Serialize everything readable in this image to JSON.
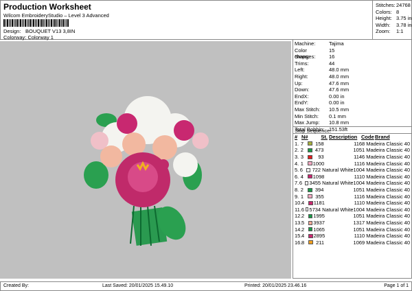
{
  "header": {
    "title": "Production Worksheet",
    "subtitle": "Wilcom EmbroideryStudio – Level 3 Advanced",
    "design_label": "Design:",
    "design": "BOUQUET V13 3,8IN",
    "colorway_label": "Colorway:",
    "colorway": "Colorway 1"
  },
  "stats": [
    {
      "k": "Stitches:",
      "v": "24768"
    },
    {
      "k": "Colors:",
      "v": "8"
    },
    {
      "k": "Height:",
      "v": "3.75 in"
    },
    {
      "k": "Width:",
      "v": "3.78 in"
    },
    {
      "k": "Zoom:",
      "v": "1:1"
    }
  ],
  "info": [
    {
      "k": "Machine:",
      "v": "Tajima"
    },
    {
      "k": "Color changes:",
      "v": "15"
    },
    {
      "k": "Stops:",
      "v": "16"
    },
    {
      "k": "Trims:",
      "v": "44"
    },
    {
      "k": "Left:",
      "v": "48.0 mm"
    },
    {
      "k": "Right:",
      "v": "48.0 mm"
    },
    {
      "k": "Up:",
      "v": "47.6 mm"
    },
    {
      "k": "Down:",
      "v": "47.6 mm"
    },
    {
      "k": "EndX:",
      "v": "0.00 in"
    },
    {
      "k": "EndY:",
      "v": "0.00 in"
    },
    {
      "k": "Max Stitch:",
      "v": "10.5 mm"
    },
    {
      "k": "Min Stitch:",
      "v": "0.1 mm"
    },
    {
      "k": "Max Jump:",
      "v": "10.8 mm"
    },
    {
      "k": "Total Bobbin:",
      "v": "151.53ft"
    }
  ],
  "sequence": {
    "title": "Stop Sequence:",
    "headers": [
      "#",
      "N#",
      "St.",
      "Description",
      "Code",
      "Brand"
    ],
    "rows": [
      [
        "1.",
        "7",
        "158",
        "",
        "1168",
        "Madeira Classic 40",
        "#a8b040"
      ],
      [
        "2.",
        "2",
        "473",
        "",
        "1051",
        "Madeira Classic 40",
        "#1a9a48"
      ],
      [
        "3.",
        "3",
        "93",
        "",
        "1146",
        "Madeira Classic 40",
        "#e02020"
      ],
      [
        "4.",
        "1",
        "1000",
        "",
        "1116",
        "Madeira Classic 40",
        "#f0a8c0"
      ],
      [
        "5.",
        "6",
        "722",
        "Natural White",
        "1004",
        "Madeira Classic 40",
        "#f0f0f0"
      ],
      [
        "6.",
        "4",
        "1098",
        "",
        "1110",
        "Madeira Classic 40",
        "#c82870"
      ],
      [
        "7.",
        "6",
        "3455",
        "Natural White",
        "1004",
        "Madeira Classic 40",
        "#f0f0f0"
      ],
      [
        "8.",
        "2",
        "394",
        "",
        "1051",
        "Madeira Classic 40",
        "#1a9a48"
      ],
      [
        "9.",
        "1",
        "355",
        "",
        "1116",
        "Madeira Classic 40",
        "#f0a8c0"
      ],
      [
        "10.",
        "4",
        "1181",
        "",
        "1110",
        "Madeira Classic 40",
        "#c82870"
      ],
      [
        "11.",
        "6",
        "5734",
        "Natural White",
        "1004",
        "Madeira Classic 40",
        "#f0f0f0"
      ],
      [
        "12.",
        "2",
        "1995",
        "",
        "1051",
        "Madeira Classic 40",
        "#1a9a48"
      ],
      [
        "13.",
        "5",
        "3937",
        "",
        "1317",
        "Madeira Classic 40",
        "#f0a898"
      ],
      [
        "14.",
        "2",
        "1065",
        "",
        "1051",
        "Madeira Classic 40",
        "#1a9a48"
      ],
      [
        "15.",
        "4",
        "2895",
        "",
        "1110",
        "Madeira Classic 40",
        "#c82870"
      ],
      [
        "16.",
        "8",
        "211",
        "",
        "1069",
        "Madeira Classic 40",
        "#f0a020"
      ]
    ]
  },
  "footer": {
    "created": "Created By:",
    "saved": "Last Saved: 20/01/2025 15.49.10",
    "printed": "Printed: 20/01/2025 23.46.16",
    "page": "Page 1 of 1"
  }
}
